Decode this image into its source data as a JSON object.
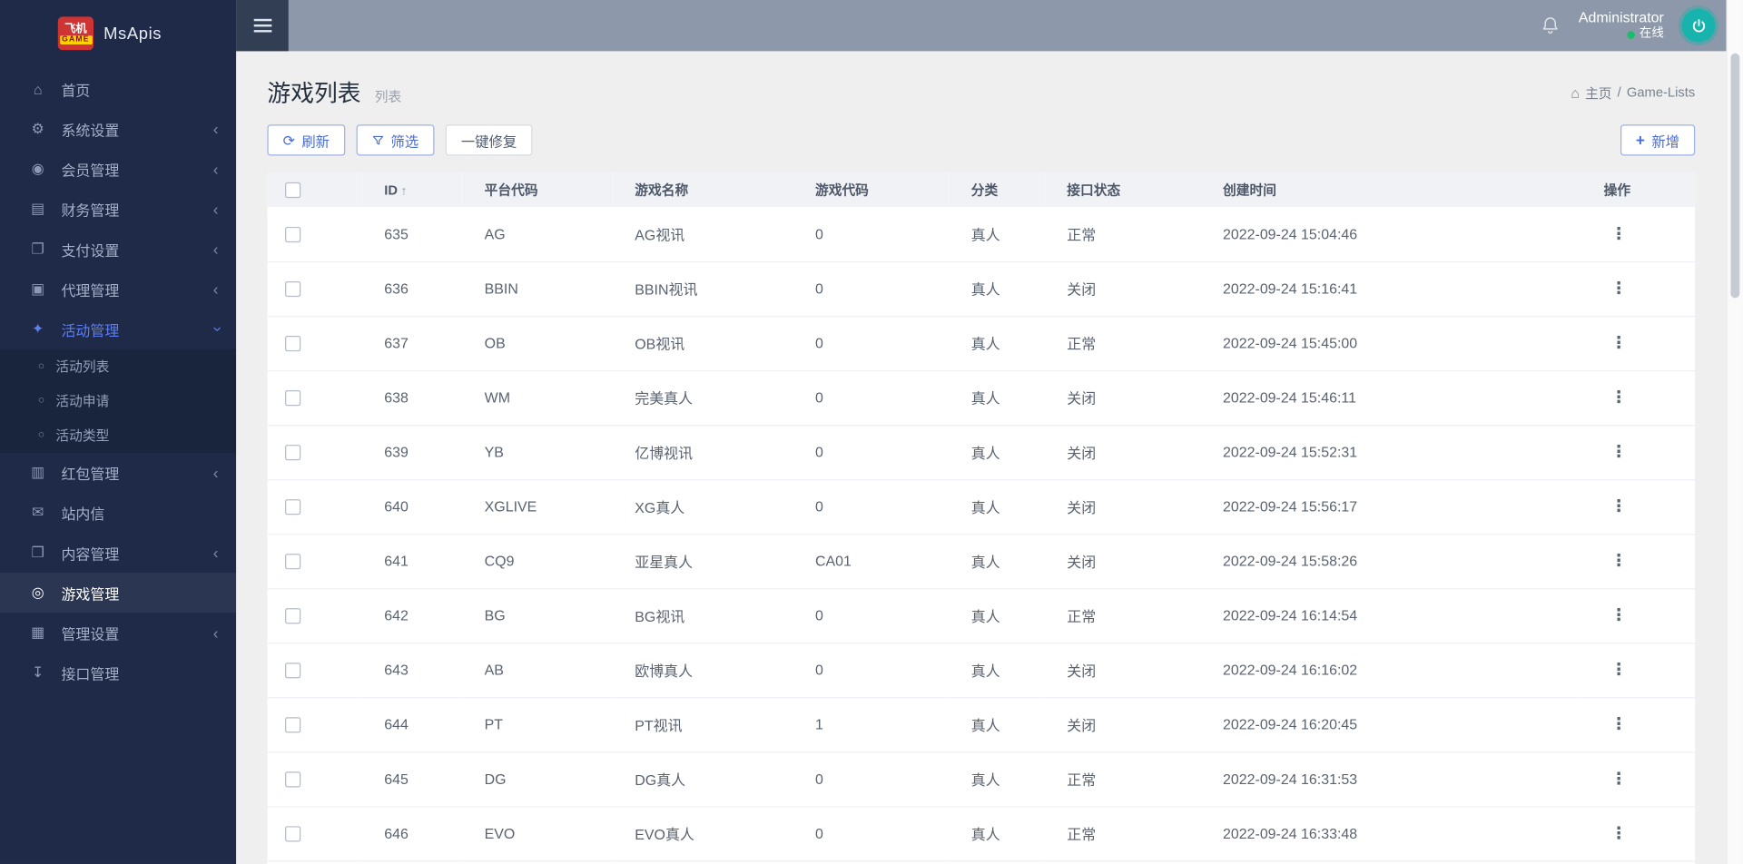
{
  "app": {
    "brand": "MsApis",
    "logo_top": "飞机",
    "logo_bottom": "GAME"
  },
  "topbar": {
    "username": "Administrator",
    "online_status": "在线"
  },
  "sidebar": {
    "items": [
      {
        "key": "home",
        "icon": "home",
        "label": "首页"
      },
      {
        "key": "system-settings",
        "icon": "gear",
        "label": "系统设置",
        "chevron": true
      },
      {
        "key": "member-manage",
        "icon": "user",
        "label": "会员管理",
        "chevron": true
      },
      {
        "key": "finance-manage",
        "icon": "finance",
        "label": "财务管理",
        "chevron": true
      },
      {
        "key": "payment-settings",
        "icon": "payment",
        "label": "支付设置",
        "chevron": true
      },
      {
        "key": "agent-manage",
        "icon": "agent",
        "label": "代理管理",
        "chevron": true
      },
      {
        "key": "activity-manage",
        "icon": "activity",
        "label": "活动管理",
        "chevron": true,
        "open": true,
        "children": [
          {
            "key": "activity-list",
            "label": "活动列表"
          },
          {
            "key": "activity-apply",
            "label": "活动申请"
          },
          {
            "key": "activity-type",
            "label": "活动类型"
          }
        ]
      },
      {
        "key": "redpacket-manage",
        "icon": "redpacket",
        "label": "红包管理",
        "chevron": true
      },
      {
        "key": "site-mail",
        "icon": "mail",
        "label": "站内信"
      },
      {
        "key": "content-manage",
        "icon": "content",
        "label": "内容管理",
        "chevron": true
      },
      {
        "key": "game-manage",
        "icon": "game",
        "label": "游戏管理",
        "selected": true
      },
      {
        "key": "admin-settings",
        "icon": "admin",
        "label": "管理设置",
        "chevron": true
      },
      {
        "key": "api-manage",
        "icon": "api",
        "label": "接口管理"
      }
    ]
  },
  "page": {
    "title": "游戏列表",
    "subtitle": "列表",
    "breadcrumb_home": "主页",
    "breadcrumb_sep": "/",
    "breadcrumb_current": "Game-Lists"
  },
  "toolbar": {
    "refresh": "刷新",
    "filter": "筛选",
    "repair": "一键修复",
    "add": "新增"
  },
  "table": {
    "columns": [
      "ID",
      "平台代码",
      "游戏名称",
      "游戏代码",
      "分类",
      "接口状态",
      "创建时间",
      "操作"
    ],
    "rows": [
      {
        "id": "635",
        "platform": "AG",
        "name": "AG视讯",
        "code": "0",
        "category": "真人",
        "status": "正常",
        "created": "2022-09-24 15:04:46"
      },
      {
        "id": "636",
        "platform": "BBIN",
        "name": "BBIN视讯",
        "code": "0",
        "category": "真人",
        "status": "关闭",
        "created": "2022-09-24 15:16:41"
      },
      {
        "id": "637",
        "platform": "OB",
        "name": "OB视讯",
        "code": "0",
        "category": "真人",
        "status": "正常",
        "created": "2022-09-24 15:45:00"
      },
      {
        "id": "638",
        "platform": "WM",
        "name": "完美真人",
        "code": "0",
        "category": "真人",
        "status": "关闭",
        "created": "2022-09-24 15:46:11"
      },
      {
        "id": "639",
        "platform": "YB",
        "name": "亿博视讯",
        "code": "0",
        "category": "真人",
        "status": "关闭",
        "created": "2022-09-24 15:52:31"
      },
      {
        "id": "640",
        "platform": "XGLIVE",
        "name": "XG真人",
        "code": "0",
        "category": "真人",
        "status": "关闭",
        "created": "2022-09-24 15:56:17"
      },
      {
        "id": "641",
        "platform": "CQ9",
        "name": "亚星真人",
        "code": "CA01",
        "category": "真人",
        "status": "关闭",
        "created": "2022-09-24 15:58:26"
      },
      {
        "id": "642",
        "platform": "BG",
        "name": "BG视讯",
        "code": "0",
        "category": "真人",
        "status": "正常",
        "created": "2022-09-24 16:14:54"
      },
      {
        "id": "643",
        "platform": "AB",
        "name": "欧博真人",
        "code": "0",
        "category": "真人",
        "status": "关闭",
        "created": "2022-09-24 16:16:02"
      },
      {
        "id": "644",
        "platform": "PT",
        "name": "PT视讯",
        "code": "1",
        "category": "真人",
        "status": "关闭",
        "created": "2022-09-24 16:20:45"
      },
      {
        "id": "645",
        "platform": "DG",
        "name": "DG真人",
        "code": "0",
        "category": "真人",
        "status": "正常",
        "created": "2022-09-24 16:31:53"
      },
      {
        "id": "646",
        "platform": "EVO",
        "name": "EVO真人",
        "code": "0",
        "category": "真人",
        "status": "正常",
        "created": "2022-09-24 16:33:48"
      }
    ]
  },
  "colors": {
    "sidebar_bg": "#1e2a48",
    "topbar_bg": "#8d99aa",
    "accent_blue": "#4a6cd4",
    "open_menu_blue": "#5d7ef0",
    "power_teal": "#17b3ad",
    "online_green": "#19be6b",
    "content_bg": "#efeff0",
    "table_header_bg": "#f1f2f6"
  }
}
